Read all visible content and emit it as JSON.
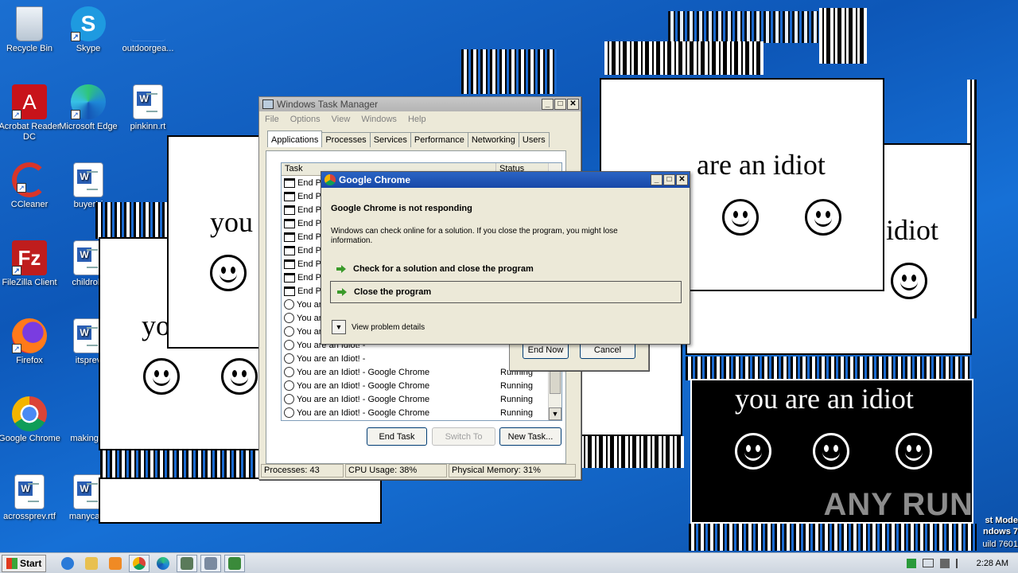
{
  "desktop": {
    "icons": [
      {
        "label": "Recycle Bin"
      },
      {
        "label": "Skype"
      },
      {
        "label": "outdoorgea..."
      },
      {
        "label": "Acrobat Reader DC"
      },
      {
        "label": "Microsoft Edge"
      },
      {
        "label": "pinkinn.rt"
      },
      {
        "label": "CCleaner"
      },
      {
        "label": "buyertri"
      },
      {
        "label": "FileZilla Client"
      },
      {
        "label": "childrole"
      },
      {
        "label": "Firefox"
      },
      {
        "label": "itsprev"
      },
      {
        "label": "Google Chrome"
      },
      {
        "label": "makingar"
      },
      {
        "label": "acrossprev.rtf"
      },
      {
        "label": "manycard"
      }
    ],
    "safe_mode": [
      "st Mode",
      "ndows 7",
      "uild 7601"
    ],
    "watermark": "ANY RUN"
  },
  "idiot_windows": {
    "text_full": "you are an idiot",
    "text_partial_1": "you",
    "text_partial_2": "yo",
    "text_partial_3": "are an idiot",
    "text_partial_4": "idiot"
  },
  "task_manager": {
    "title": "Windows Task Manager",
    "menu": [
      "File",
      "Options",
      "View",
      "Windows",
      "Help"
    ],
    "tabs": [
      "Applications",
      "Processes",
      "Services",
      "Performance",
      "Networking",
      "Users"
    ],
    "columns": {
      "task": "Task",
      "status": "Status"
    },
    "rows": [
      {
        "task": "End Pr",
        "status": ""
      },
      {
        "task": "End Pr",
        "status": ""
      },
      {
        "task": "End Pr",
        "status": ""
      },
      {
        "task": "End Pr",
        "status": ""
      },
      {
        "task": "End Pr",
        "status": ""
      },
      {
        "task": "End Pr",
        "status": ""
      },
      {
        "task": "End Pr",
        "status": ""
      },
      {
        "task": "End Pr",
        "status": ""
      },
      {
        "task": "End Pr",
        "status": ""
      },
      {
        "task": "You ar",
        "status": ""
      },
      {
        "task": "You ar",
        "status": ""
      },
      {
        "task": "You ar",
        "status": ""
      },
      {
        "task": "You are an Idiot! -",
        "status": ""
      },
      {
        "task": "You are an Idiot! -",
        "status": ""
      },
      {
        "task": "You are an Idiot! - Google Chrome",
        "status": "Running"
      },
      {
        "task": "You are an Idiot! - Google Chrome",
        "status": "Running"
      },
      {
        "task": "You are an Idiot! - Google Chrome",
        "status": "Running"
      },
      {
        "task": "You are an Idiot! - Google Chrome",
        "status": "Running"
      }
    ],
    "buttons": {
      "end_task": "End Task",
      "switch_to": "Switch To",
      "new_task": "New Task..."
    },
    "status_bar": {
      "processes": "Processes: 43",
      "cpu": "CPU Usage: 38%",
      "memory": "Physical Memory: 31%"
    }
  },
  "behind_dialog": {
    "end_now": "End Now",
    "cancel": "Cancel"
  },
  "chrome_dialog": {
    "title": "Google Chrome",
    "heading": "Google Chrome is not responding",
    "body": "Windows can check online for a solution. If you close the program, you might lose information.",
    "option_1": "Check for a solution and close the program",
    "option_2": "Close the program",
    "details": "View problem details"
  },
  "taskbar": {
    "start": "Start",
    "time": "2:28 AM"
  }
}
